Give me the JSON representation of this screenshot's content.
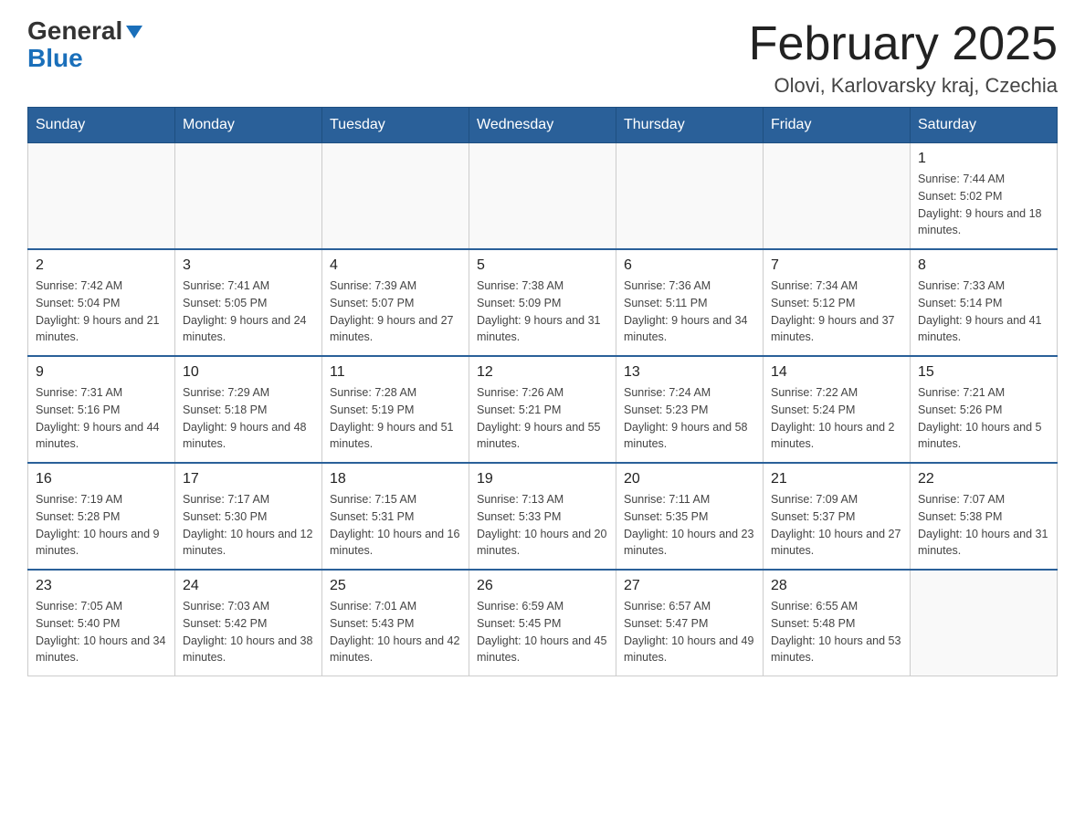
{
  "logo": {
    "general": "General",
    "blue": "Blue"
  },
  "title": "February 2025",
  "location": "Olovi, Karlovarsky kraj, Czechia",
  "days_of_week": [
    "Sunday",
    "Monday",
    "Tuesday",
    "Wednesday",
    "Thursday",
    "Friday",
    "Saturday"
  ],
  "weeks": [
    [
      {
        "day": "",
        "info": ""
      },
      {
        "day": "",
        "info": ""
      },
      {
        "day": "",
        "info": ""
      },
      {
        "day": "",
        "info": ""
      },
      {
        "day": "",
        "info": ""
      },
      {
        "day": "",
        "info": ""
      },
      {
        "day": "1",
        "info": "Sunrise: 7:44 AM\nSunset: 5:02 PM\nDaylight: 9 hours and 18 minutes."
      }
    ],
    [
      {
        "day": "2",
        "info": "Sunrise: 7:42 AM\nSunset: 5:04 PM\nDaylight: 9 hours and 21 minutes."
      },
      {
        "day": "3",
        "info": "Sunrise: 7:41 AM\nSunset: 5:05 PM\nDaylight: 9 hours and 24 minutes."
      },
      {
        "day": "4",
        "info": "Sunrise: 7:39 AM\nSunset: 5:07 PM\nDaylight: 9 hours and 27 minutes."
      },
      {
        "day": "5",
        "info": "Sunrise: 7:38 AM\nSunset: 5:09 PM\nDaylight: 9 hours and 31 minutes."
      },
      {
        "day": "6",
        "info": "Sunrise: 7:36 AM\nSunset: 5:11 PM\nDaylight: 9 hours and 34 minutes."
      },
      {
        "day": "7",
        "info": "Sunrise: 7:34 AM\nSunset: 5:12 PM\nDaylight: 9 hours and 37 minutes."
      },
      {
        "day": "8",
        "info": "Sunrise: 7:33 AM\nSunset: 5:14 PM\nDaylight: 9 hours and 41 minutes."
      }
    ],
    [
      {
        "day": "9",
        "info": "Sunrise: 7:31 AM\nSunset: 5:16 PM\nDaylight: 9 hours and 44 minutes."
      },
      {
        "day": "10",
        "info": "Sunrise: 7:29 AM\nSunset: 5:18 PM\nDaylight: 9 hours and 48 minutes."
      },
      {
        "day": "11",
        "info": "Sunrise: 7:28 AM\nSunset: 5:19 PM\nDaylight: 9 hours and 51 minutes."
      },
      {
        "day": "12",
        "info": "Sunrise: 7:26 AM\nSunset: 5:21 PM\nDaylight: 9 hours and 55 minutes."
      },
      {
        "day": "13",
        "info": "Sunrise: 7:24 AM\nSunset: 5:23 PM\nDaylight: 9 hours and 58 minutes."
      },
      {
        "day": "14",
        "info": "Sunrise: 7:22 AM\nSunset: 5:24 PM\nDaylight: 10 hours and 2 minutes."
      },
      {
        "day": "15",
        "info": "Sunrise: 7:21 AM\nSunset: 5:26 PM\nDaylight: 10 hours and 5 minutes."
      }
    ],
    [
      {
        "day": "16",
        "info": "Sunrise: 7:19 AM\nSunset: 5:28 PM\nDaylight: 10 hours and 9 minutes."
      },
      {
        "day": "17",
        "info": "Sunrise: 7:17 AM\nSunset: 5:30 PM\nDaylight: 10 hours and 12 minutes."
      },
      {
        "day": "18",
        "info": "Sunrise: 7:15 AM\nSunset: 5:31 PM\nDaylight: 10 hours and 16 minutes."
      },
      {
        "day": "19",
        "info": "Sunrise: 7:13 AM\nSunset: 5:33 PM\nDaylight: 10 hours and 20 minutes."
      },
      {
        "day": "20",
        "info": "Sunrise: 7:11 AM\nSunset: 5:35 PM\nDaylight: 10 hours and 23 minutes."
      },
      {
        "day": "21",
        "info": "Sunrise: 7:09 AM\nSunset: 5:37 PM\nDaylight: 10 hours and 27 minutes."
      },
      {
        "day": "22",
        "info": "Sunrise: 7:07 AM\nSunset: 5:38 PM\nDaylight: 10 hours and 31 minutes."
      }
    ],
    [
      {
        "day": "23",
        "info": "Sunrise: 7:05 AM\nSunset: 5:40 PM\nDaylight: 10 hours and 34 minutes."
      },
      {
        "day": "24",
        "info": "Sunrise: 7:03 AM\nSunset: 5:42 PM\nDaylight: 10 hours and 38 minutes."
      },
      {
        "day": "25",
        "info": "Sunrise: 7:01 AM\nSunset: 5:43 PM\nDaylight: 10 hours and 42 minutes."
      },
      {
        "day": "26",
        "info": "Sunrise: 6:59 AM\nSunset: 5:45 PM\nDaylight: 10 hours and 45 minutes."
      },
      {
        "day": "27",
        "info": "Sunrise: 6:57 AM\nSunset: 5:47 PM\nDaylight: 10 hours and 49 minutes."
      },
      {
        "day": "28",
        "info": "Sunrise: 6:55 AM\nSunset: 5:48 PM\nDaylight: 10 hours and 53 minutes."
      },
      {
        "day": "",
        "info": ""
      }
    ]
  ]
}
